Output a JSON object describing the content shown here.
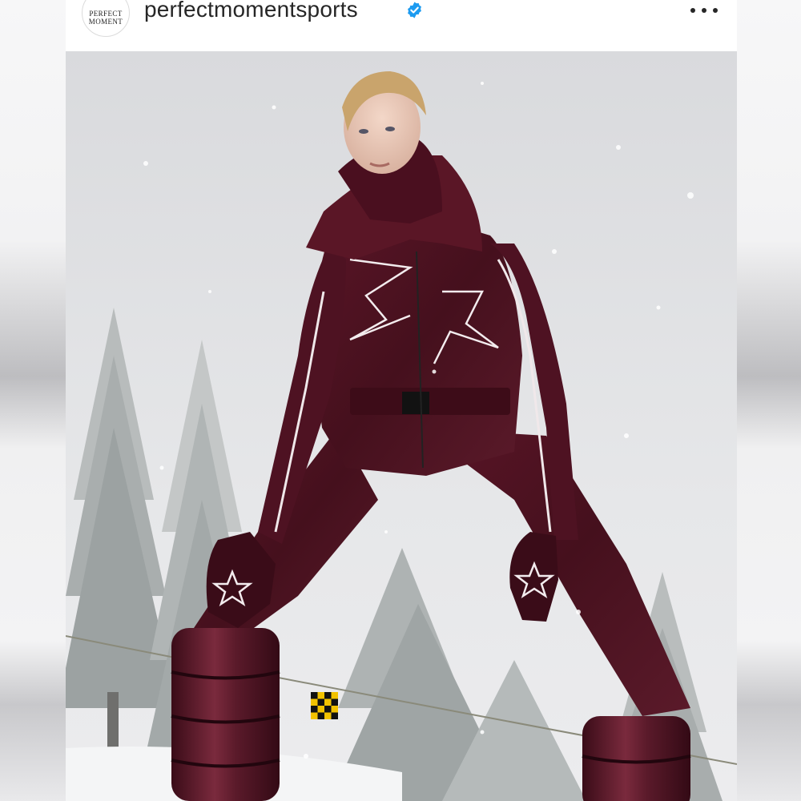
{
  "post": {
    "account": {
      "username": "perfectmomentsports",
      "avatar_text": [
        "PERFECT",
        "MOMENT"
      ],
      "verified": true
    },
    "icons": {
      "verified": "verified-badge-icon",
      "more": "more-options-icon"
    },
    "colors": {
      "verified_blue": "#1d9bf0",
      "text": "#262626",
      "suit_burgundy": "#4a1020"
    }
  }
}
